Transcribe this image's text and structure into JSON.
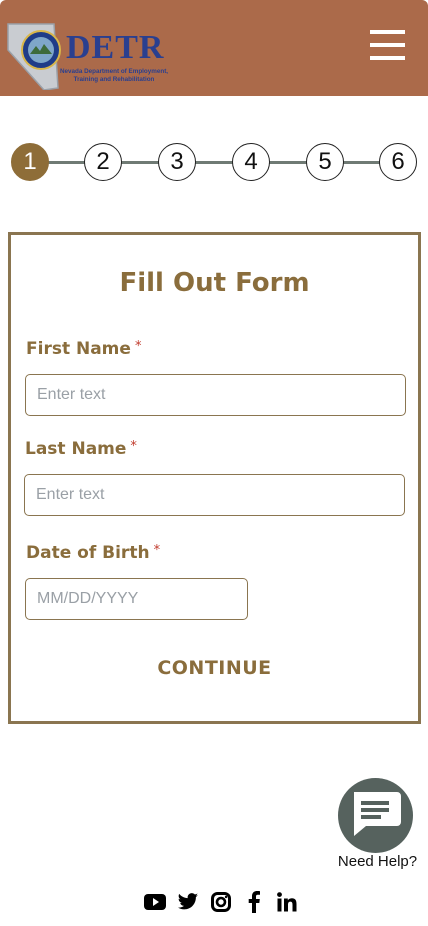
{
  "header": {
    "logo_text": "DETR",
    "logo_subtitle": "Nevada Department of Employment, Training and Rehabilitation",
    "brand_color": "#ab6a4a",
    "menu_icon": "hamburger-menu-icon"
  },
  "stepper": {
    "steps": [
      "1",
      "2",
      "3",
      "4",
      "5",
      "6"
    ],
    "current_step": "1",
    "active_color": "#8e6d38"
  },
  "form": {
    "title": "Fill Out Form",
    "required_mark": "*",
    "first_name": {
      "label": "First Name",
      "placeholder": "Enter text",
      "value": ""
    },
    "last_name": {
      "label": "Last Name",
      "placeholder": "Enter text",
      "value": ""
    },
    "dob": {
      "label": "Date of Birth",
      "placeholder": "MM/DD/YYYY",
      "value": ""
    },
    "continue_label": "CONTINUE",
    "accent_color": "#8a6d3c"
  },
  "help": {
    "label": "Need Help?",
    "icon": "chat-bubble-icon"
  },
  "social": {
    "icons": [
      "youtube-icon",
      "twitter-icon",
      "instagram-icon",
      "facebook-icon",
      "linkedin-icon"
    ]
  }
}
